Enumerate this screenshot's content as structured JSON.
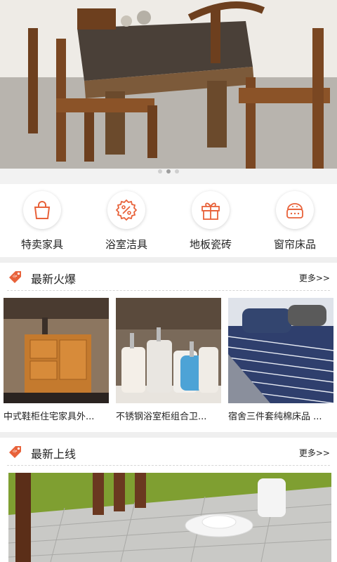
{
  "banner": {
    "dots_count": 3,
    "active_dot": 1
  },
  "categories": [
    {
      "label": "特卖家具",
      "icon": "shopping-bag-icon"
    },
    {
      "label": "浴室洁具",
      "icon": "percent-badge-icon"
    },
    {
      "label": "地板瓷砖",
      "icon": "gift-box-icon"
    },
    {
      "label": "窗帘床品",
      "icon": "basket-icon"
    }
  ],
  "sections": {
    "hot": {
      "title": "最新火爆",
      "more": "更多>>"
    },
    "new": {
      "title": "最新上线",
      "more": "更多>>"
    }
  },
  "products": [
    {
      "name": "中式鞋柜住宅家具外..."
    },
    {
      "name": "不锈钢浴室柜组合卫..."
    },
    {
      "name": "宿舍三件套纯棉床品 ..."
    }
  ],
  "colors": {
    "accent": "#e8623a",
    "page_bg": "#ffffff",
    "divider": "#efefef"
  }
}
